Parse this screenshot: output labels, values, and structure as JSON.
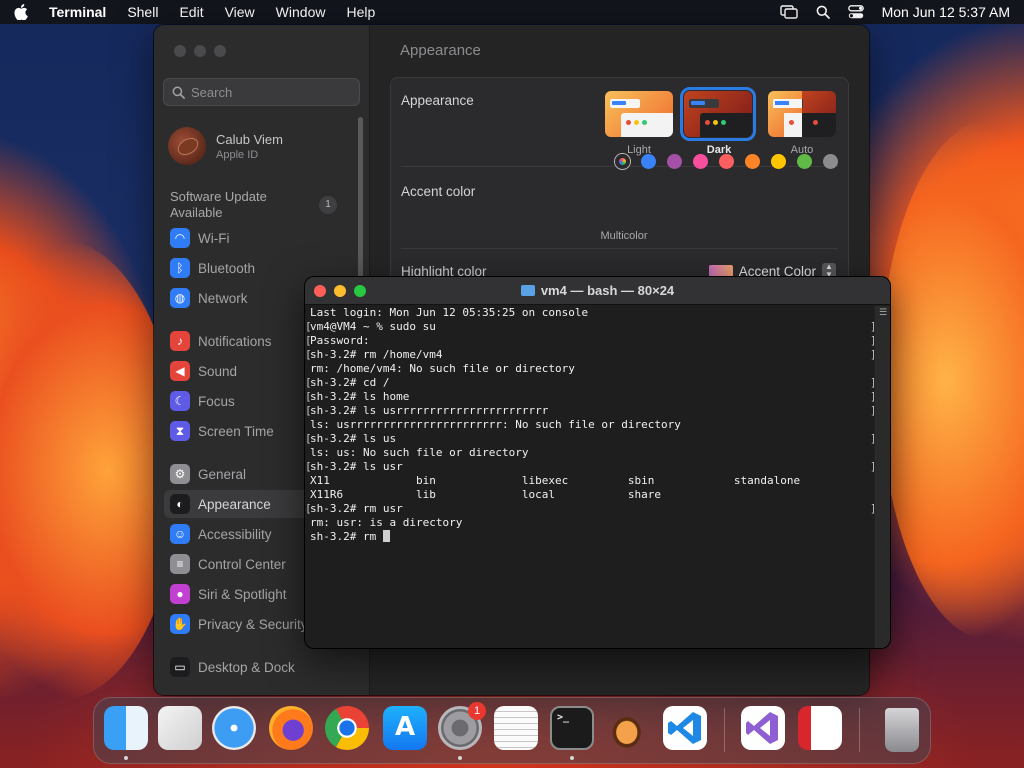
{
  "menubar": {
    "items": [
      "Terminal",
      "Shell",
      "Edit",
      "View",
      "Window",
      "Help"
    ],
    "datetime": "Mon Jun 12  5:37 AM"
  },
  "settings": {
    "search_placeholder": "Search",
    "profile": {
      "name": "Calub Viem",
      "subtitle": "Apple ID"
    },
    "software_update": {
      "label": "Software Update Available",
      "badge": "1"
    },
    "sidebar": [
      {
        "label": "Wi-Fi",
        "icon": "wifi-icon",
        "color": "#2f7cf6"
      },
      {
        "label": "Bluetooth",
        "icon": "bluetooth-icon",
        "color": "#2f7cf6"
      },
      {
        "label": "Network",
        "icon": "globe-icon",
        "color": "#2f7cf6"
      },
      {
        "label": "Notifications",
        "icon": "bell-icon",
        "color": "#e5443a"
      },
      {
        "label": "Sound",
        "icon": "speaker-icon",
        "color": "#e5443a"
      },
      {
        "label": "Focus",
        "icon": "moon-icon",
        "color": "#5e5ce6"
      },
      {
        "label": "Screen Time",
        "icon": "hourglass-icon",
        "color": "#5e5ce6"
      },
      {
        "label": "General",
        "icon": "gear-icon",
        "color": "#8e8e93"
      },
      {
        "label": "Appearance",
        "icon": "appearance-icon",
        "color": "#1c1c1e"
      },
      {
        "label": "Accessibility",
        "icon": "accessibility-icon",
        "color": "#2f7cf6"
      },
      {
        "label": "Control Center",
        "icon": "control-center-icon",
        "color": "#8e8e93"
      },
      {
        "label": "Siri & Spotlight",
        "icon": "siri-icon",
        "color": "#c13fd1"
      },
      {
        "label": "Privacy & Security",
        "icon": "hand-icon",
        "color": "#2f7cf6"
      },
      {
        "label": "Desktop & Dock",
        "icon": "dock-icon",
        "color": "#1c1c1e"
      }
    ],
    "selected_item": "Appearance",
    "content_title": "Appearance",
    "appearance_label": "Appearance",
    "modes": [
      "Light",
      "Dark",
      "Auto"
    ],
    "selected_mode": "Dark",
    "accent_label": "Accent color",
    "accent_selected_label": "Multicolor",
    "accent_colors": [
      "multicolor",
      "#3a82f7",
      "#a550a7",
      "#f74f9e",
      "#fc5f5f",
      "#fd8426",
      "#ffc600",
      "#62ba46",
      "#8c8c8c"
    ],
    "highlight_label": "Highlight color",
    "highlight_value": "Accent Color"
  },
  "terminal": {
    "title": "vm4 — bash — 80×24",
    "lines": [
      {
        "text": "Last login: Mon Jun 12 05:35:25 on console",
        "mark": false
      },
      {
        "text": "vm4@VM4 ~ % sudo su",
        "mark": true
      },
      {
        "text": "Password:",
        "mark": true
      },
      {
        "text": "sh-3.2# rm /home/vm4",
        "mark": true
      },
      {
        "text": "rm: /home/vm4: No such file or directory",
        "mark": false
      },
      {
        "text": "sh-3.2# cd /",
        "mark": true
      },
      {
        "text": "sh-3.2# ls home",
        "mark": true
      },
      {
        "text": "sh-3.2# ls usrrrrrrrrrrrrrrrrrrrrrrr",
        "mark": true
      },
      {
        "text": "ls: usrrrrrrrrrrrrrrrrrrrrrrr: No such file or directory",
        "mark": false
      },
      {
        "text": "sh-3.2# ls us",
        "mark": true
      },
      {
        "text": "ls: us: No such file or directory",
        "mark": false
      },
      {
        "text": "sh-3.2# ls usr",
        "mark": true
      },
      {
        "text": "X11             bin             libexec         sbin            standalone",
        "mark": false
      },
      {
        "text": "X11R6           lib             local           share",
        "mark": false
      },
      {
        "text": "sh-3.2# rm usr",
        "mark": true
      },
      {
        "text": "rm: usr: is a directory",
        "mark": false
      },
      {
        "text": "sh-3.2# rm ",
        "mark": false,
        "cursor": true
      }
    ]
  },
  "dock": {
    "apps": [
      {
        "name": "Finder",
        "icon": "finder-icon",
        "running": true
      },
      {
        "name": "Launchpad",
        "icon": "launchpad-icon",
        "running": false
      },
      {
        "name": "Safari",
        "icon": "safari-icon",
        "running": false
      },
      {
        "name": "Firefox",
        "icon": "firefox-icon",
        "running": false
      },
      {
        "name": "Chrome",
        "icon": "chrome-icon",
        "running": false
      },
      {
        "name": "App Store",
        "icon": "app-store-icon",
        "running": false
      },
      {
        "name": "System Settings",
        "icon": "system-settings-icon",
        "running": true,
        "badge": "1"
      },
      {
        "name": "TextEdit",
        "icon": "textedit-icon",
        "running": false
      },
      {
        "name": "Terminal",
        "icon": "terminal-icon",
        "running": true
      },
      {
        "name": "GarageBand",
        "icon": "garageband-icon",
        "running": false
      },
      {
        "name": "Visual Studio Code",
        "icon": "vscode-icon",
        "running": false
      },
      {
        "name": "Visual Studio",
        "icon": "visual-studio-icon",
        "running": false
      },
      {
        "name": "Parallels",
        "icon": "parallels-icon",
        "running": false
      },
      {
        "name": "Trash",
        "icon": "trash-icon",
        "running": false
      }
    ]
  }
}
